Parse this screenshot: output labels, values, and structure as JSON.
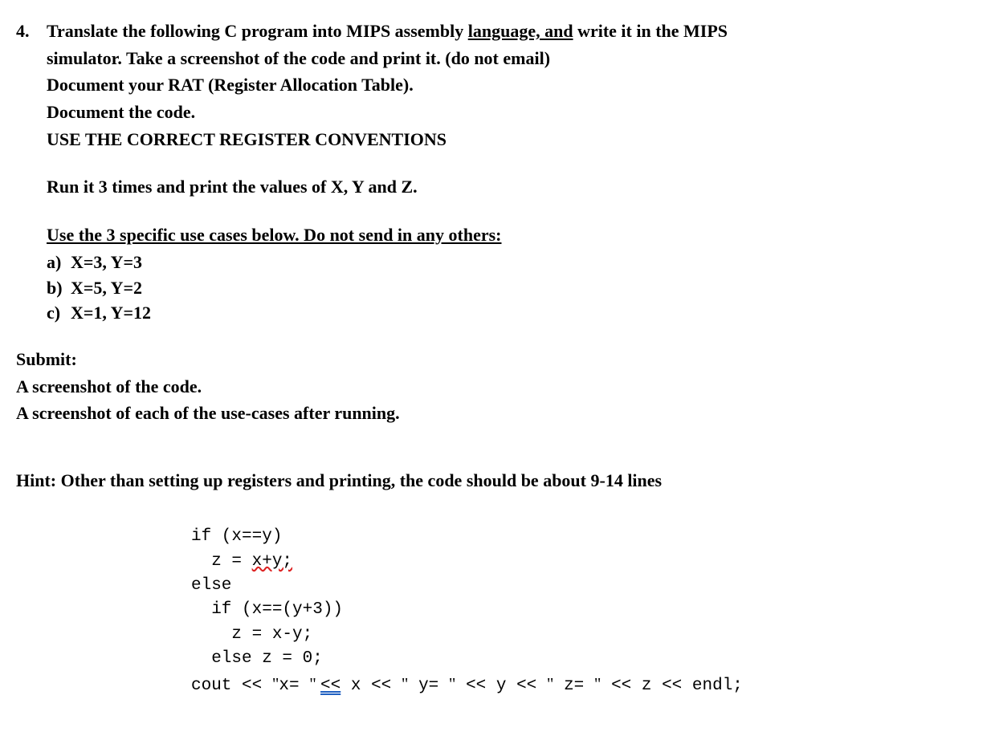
{
  "q_number": "4.",
  "line1_pre": "Translate the following C program into MIPS assembly ",
  "line1_und": "language, and",
  "line1_post": " write it in the MIPS",
  "line2": "simulator. Take a screenshot of the code and print it. (do not email)",
  "line3": "Document your RAT (Register Allocation Table).",
  "line4": "Document the code.",
  "line5": "USE THE CORRECT REGISTER CONVENTIONS",
  "run_line": "Run it 3 times and print the values of X, Y and Z.",
  "usecases_heading": "Use the 3 specific use cases below. Do not send in any others:",
  "cases": [
    {
      "letter": "a)",
      "text": "X=3, Y=3"
    },
    {
      "letter": "b)",
      "text": "X=5, Y=2"
    },
    {
      "letter": "c)",
      "text": "X=1, Y=12"
    }
  ],
  "submit_heading": "Submit:",
  "submit1": "A screenshot of the code.",
  "submit2": "A screenshot of each of the use-cases after running.",
  "hint": "Hint: Other than setting up registers and printing, the code should be about 9-14 lines",
  "code": {
    "l1": "if (x==y)",
    "l2a": "  z = ",
    "l2b": "x+y;",
    "l3": "else",
    "l4": "  if (x==(y+3))",
    "l5": "    z = x-y;",
    "l6": "  else z = 0;",
    "l7a": "cout << ",
    "l7b": "\"",
    "l7c": "x= ",
    "l7d": "\" ",
    "l7e": "<<",
    "l7f": " x << ",
    "l7g": "\"",
    "l7h": " y= ",
    "l7i": "\"",
    "l7j": " << y << ",
    "l7k": "\"",
    "l7l": " z= ",
    "l7m": "\"",
    "l7n": " << z << endl;"
  }
}
